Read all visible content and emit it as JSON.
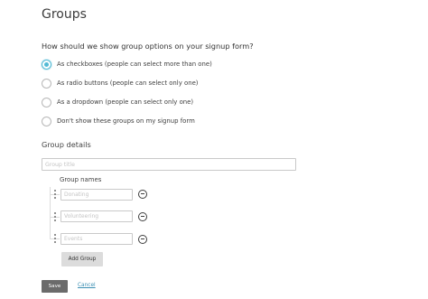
{
  "page": {
    "title": "Groups"
  },
  "display_options": {
    "question": "How should we show group options on your signup form?",
    "options": [
      {
        "label": "As checkboxes (people can select more than one)",
        "selected": true
      },
      {
        "label": "As radio buttons (people can select only one)",
        "selected": false
      },
      {
        "label": "As a dropdown (people can select only one)",
        "selected": false
      },
      {
        "label": "Don't show these groups on my signup form",
        "selected": false
      }
    ]
  },
  "group_details": {
    "heading": "Group details",
    "title_placeholder": "Group title",
    "names_label": "Group names",
    "names": [
      {
        "placeholder": "Donating",
        "value": ""
      },
      {
        "placeholder": "Volunteering",
        "value": ""
      },
      {
        "placeholder": "Events",
        "value": ""
      }
    ],
    "add_group_label": "Add Group"
  },
  "footer": {
    "save_label": "Save",
    "cancel_label": "Cancel"
  },
  "colors": {
    "accent": "#52bad5",
    "save_button": "#6b6b6b",
    "link": "#3b8fb3"
  }
}
